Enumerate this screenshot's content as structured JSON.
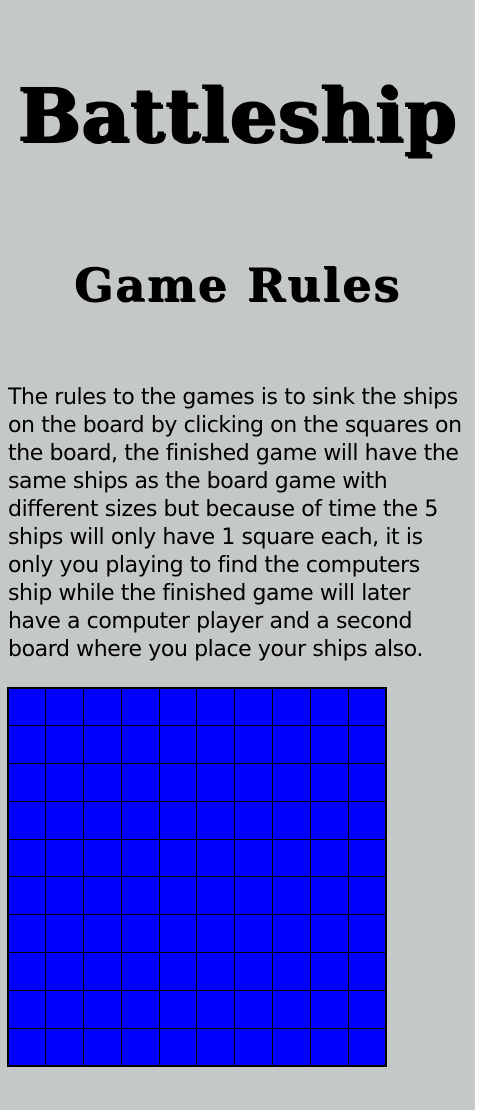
{
  "header": {
    "title": "Battleship",
    "subtitle": "Game Rules"
  },
  "rules": {
    "text": "The rules to the games is to sink the ships on the board by clicking on the squares on the board, the finished game will have the same ships as the board game with different sizes but because of time the 5 ships will only have 1 square each, it is only you playing to find the computers ship while the finished game will later have a computer player and a second board where you place your ships also."
  },
  "board": {
    "rows": 10,
    "cols": 10,
    "cell_color": "#0000ff",
    "grid_line_color": "#000000"
  },
  "colors": {
    "background": "#c4c8c6",
    "text": "#000000"
  }
}
